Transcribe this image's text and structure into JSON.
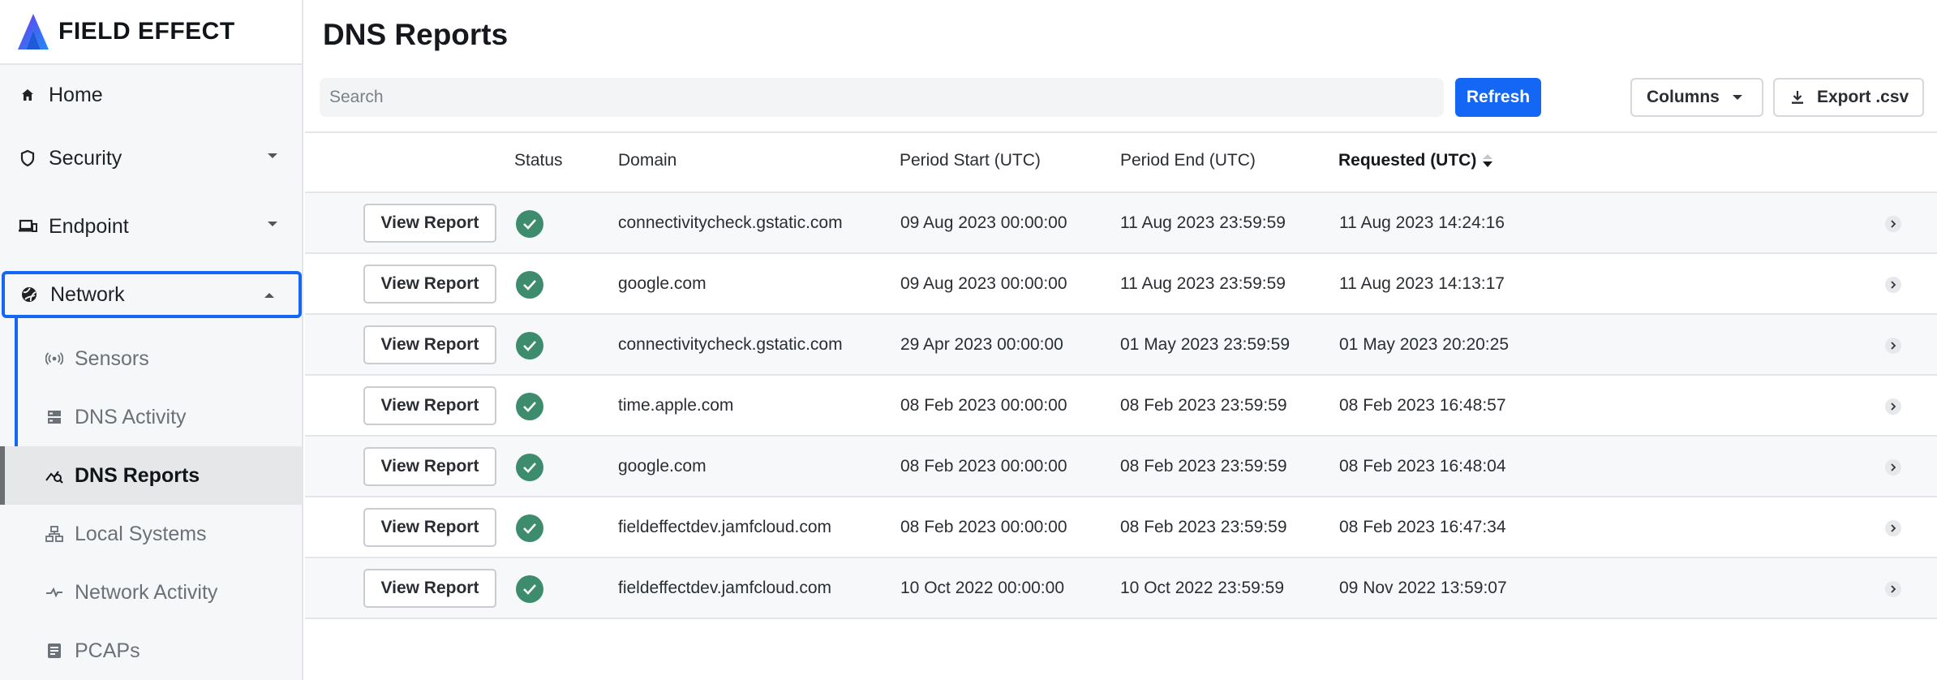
{
  "brand": {
    "name": "FIELD EFFECT"
  },
  "sidebar": {
    "home": "Home",
    "security": "Security",
    "endpoint": "Endpoint",
    "network": "Network",
    "network_items": {
      "sensors": "Sensors",
      "dns_activity": "DNS Activity",
      "dns_reports": "DNS Reports",
      "local_systems": "Local Systems",
      "network_activity": "Network Activity",
      "pcaps": "PCAPs"
    }
  },
  "page": {
    "title": "DNS Reports"
  },
  "toolbar": {
    "search_placeholder": "Search",
    "refresh_label": "Refresh",
    "columns_label": "Columns",
    "export_label": "Export .csv"
  },
  "table": {
    "headers": {
      "status": "Status",
      "domain": "Domain",
      "period_start": "Period Start (UTC)",
      "period_end": "Period End (UTC)",
      "requested": "Requested (UTC)"
    },
    "view_label": "View Report",
    "rows": [
      {
        "domain": "connectivitycheck.gstatic.com",
        "period_start": "09 Aug 2023 00:00:00",
        "period_end": "11 Aug 2023 23:59:59",
        "requested": "11 Aug 2023 14:24:16"
      },
      {
        "domain": "google.com",
        "period_start": "09 Aug 2023 00:00:00",
        "period_end": "11 Aug 2023 23:59:59",
        "requested": "11 Aug 2023 14:13:17"
      },
      {
        "domain": "connectivitycheck.gstatic.com",
        "period_start": "29 Apr 2023 00:00:00",
        "period_end": "01 May 2023 23:59:59",
        "requested": "01 May 2023 20:20:25"
      },
      {
        "domain": "time.apple.com",
        "period_start": "08 Feb 2023 00:00:00",
        "period_end": "08 Feb 2023 23:59:59",
        "requested": "08 Feb 2023 16:48:57"
      },
      {
        "domain": "google.com",
        "period_start": "08 Feb 2023 00:00:00",
        "period_end": "08 Feb 2023 23:59:59",
        "requested": "08 Feb 2023 16:48:04"
      },
      {
        "domain": "fieldeffectdev.jamfcloud.com",
        "period_start": "08 Feb 2023 00:00:00",
        "period_end": "08 Feb 2023 23:59:59",
        "requested": "08 Feb 2023 16:47:34"
      },
      {
        "domain": "fieldeffectdev.jamfcloud.com",
        "period_start": "10 Oct 2022 00:00:00",
        "period_end": "10 Oct 2022 23:59:59",
        "requested": "09 Nov 2022 13:59:07"
      }
    ]
  },
  "colors": {
    "accent": "#1466f5",
    "status_ok": "#3d8c6e"
  }
}
